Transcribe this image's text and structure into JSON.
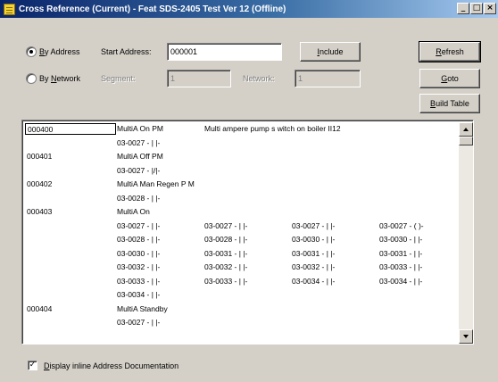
{
  "window": {
    "title": "Cross Reference (Current) - Feat SDS-2405 Test Ver 12 (Offline)",
    "minimize_glyph": "_",
    "maximize_glyph": "□",
    "close_glyph": "×"
  },
  "search": {
    "by_address_accel": "B",
    "by_address_rest": "y Address",
    "start_address_label": "Start Address:",
    "start_address_value": "000001",
    "by_network_prefix": "By ",
    "by_network_accel": "N",
    "by_network_rest": "etwork",
    "segment_label": "Segment:",
    "segment_value": "1",
    "network_label": "Network:",
    "network_value": "1",
    "include_accel": "I",
    "include_rest": "nclude"
  },
  "buttons": {
    "refresh_accel": "R",
    "refresh_rest": "efresh",
    "goto_accel": "G",
    "goto_rest": "oto",
    "build_table_accel": "B",
    "build_table_rest": "uild Table"
  },
  "listing": [
    {
      "address": "000400",
      "cells": [
        "MultiA On PM"
      ],
      "description": "Multi ampere pump s witch on boiler II12"
    },
    {
      "address": "",
      "cells": [
        "03-0027 - | |-"
      ]
    },
    {
      "address": "000401",
      "cells": [
        " MultiA Off PM"
      ]
    },
    {
      "address": "",
      "cells": [
        "03-0027 - |/|-"
      ]
    },
    {
      "address": "000402",
      "cells": [
        "MultiA Man Regen P M"
      ]
    },
    {
      "address": "",
      "cells": [
        "03-0028 - | |-"
      ]
    },
    {
      "address": "000403",
      "cells": [
        "MultiA On"
      ]
    },
    {
      "address": "",
      "cells": [
        "03-0027 - | |-",
        "03-0027 - | |-",
        "03-0027 - | |-",
        "03-0027 - ( )-"
      ]
    },
    {
      "address": "",
      "cells": [
        "03-0028 - | |-",
        "03-0028 - | |-",
        "03-0030 - | |-",
        "03-0030 - | |-"
      ]
    },
    {
      "address": "",
      "cells": [
        "03-0030 - | |-",
        "03-0031 - | |-",
        "03-0031 - | |-",
        "03-0031 - | |-"
      ]
    },
    {
      "address": "",
      "cells": [
        "03-0032 - | |-",
        "03-0032 - | |-",
        "03-0032 - | |-",
        "03-0033 - | |-"
      ]
    },
    {
      "address": "",
      "cells": [
        "03-0033 - | |-",
        "03-0033 - | |-",
        "03-0034 - | |-",
        "03-0034 - | |-"
      ]
    },
    {
      "address": "",
      "cells": [
        "03-0034 - | |-"
      ]
    },
    {
      "address": "000404",
      "cells": [
        "MultiA Standby"
      ]
    },
    {
      "address": "",
      "cells": [
        "03-0027 - | |-"
      ]
    }
  ],
  "footer": {
    "checkbox_glyph": "✓",
    "display_inline_accel": "D",
    "display_inline_rest": "isplay inline Address Documentation"
  },
  "state": {
    "mode": "by_address",
    "display_inline_checked": true
  }
}
